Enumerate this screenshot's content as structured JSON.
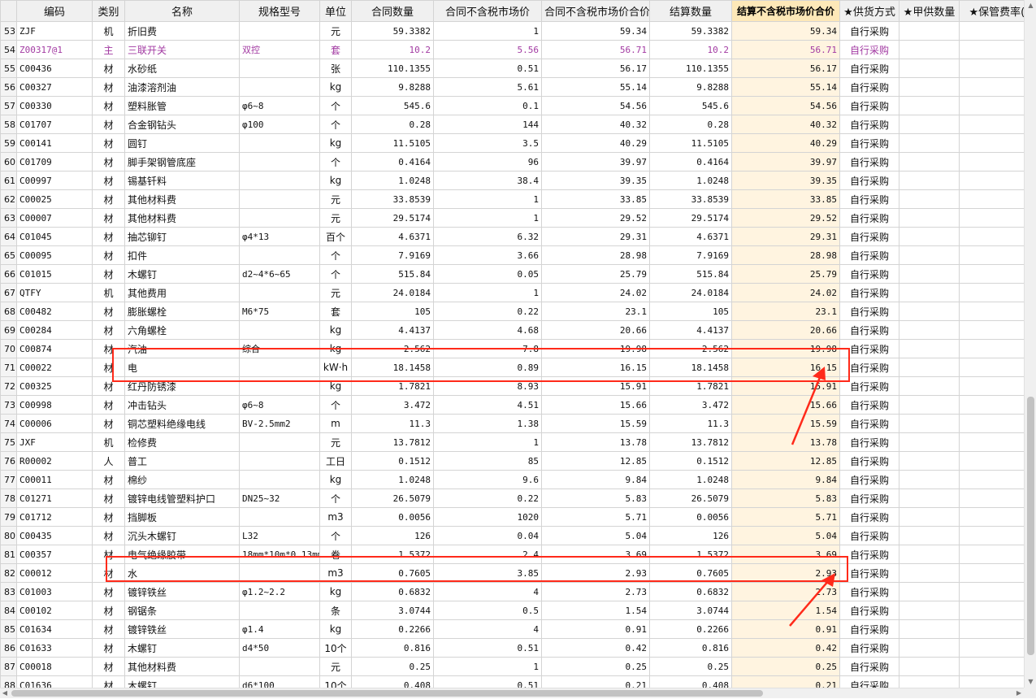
{
  "columns": [
    "编码",
    "类别",
    "名称",
    "规格型号",
    "单位",
    "合同数量",
    "合同不含税市场价",
    "合同不含税市场价合价",
    "结算数量",
    "结算不含税市场价合价",
    "★供货方式",
    "★甲供数量",
    "★保管费率(%"
  ],
  "rows": [
    {
      "n": "53",
      "code": "ZJF",
      "type": "机",
      "name": "折旧费",
      "spec": "",
      "unit": "元",
      "qty": "59.3382",
      "price": "1",
      "total": "59.34",
      "sqty": "59.3382",
      "stotal": "59.34",
      "supply": "自行采购"
    },
    {
      "n": "54",
      "code": "Z00317@1",
      "type": "主",
      "name": "三联开关",
      "spec": "双控",
      "unit": "套",
      "qty": "10.2",
      "price": "5.56",
      "total": "56.71",
      "sqty": "10.2",
      "stotal": "56.71",
      "supply": "自行采购",
      "purple": true
    },
    {
      "n": "55",
      "code": "C00436",
      "type": "材",
      "name": "水砂纸",
      "spec": "",
      "unit": "张",
      "qty": "110.1355",
      "price": "0.51",
      "total": "56.17",
      "sqty": "110.1355",
      "stotal": "56.17",
      "supply": "自行采购"
    },
    {
      "n": "56",
      "code": "C00327",
      "type": "材",
      "name": "油漆溶剂油",
      "spec": "",
      "unit": "kg",
      "qty": "9.8288",
      "price": "5.61",
      "total": "55.14",
      "sqty": "9.8288",
      "stotal": "55.14",
      "supply": "自行采购"
    },
    {
      "n": "57",
      "code": "C00330",
      "type": "材",
      "name": "塑料胀管",
      "spec": "φ6~8",
      "unit": "个",
      "qty": "545.6",
      "price": "0.1",
      "total": "54.56",
      "sqty": "545.6",
      "stotal": "54.56",
      "supply": "自行采购"
    },
    {
      "n": "58",
      "code": "C01707",
      "type": "材",
      "name": "合金钢钻头",
      "spec": "φ100",
      "unit": "个",
      "qty": "0.28",
      "price": "144",
      "total": "40.32",
      "sqty": "0.28",
      "stotal": "40.32",
      "supply": "自行采购"
    },
    {
      "n": "59",
      "code": "C00141",
      "type": "材",
      "name": "圆钉",
      "spec": "",
      "unit": "kg",
      "qty": "11.5105",
      "price": "3.5",
      "total": "40.29",
      "sqty": "11.5105",
      "stotal": "40.29",
      "supply": "自行采购"
    },
    {
      "n": "60",
      "code": "C01709",
      "type": "材",
      "name": "脚手架钢管底座",
      "spec": "",
      "unit": "个",
      "qty": "0.4164",
      "price": "96",
      "total": "39.97",
      "sqty": "0.4164",
      "stotal": "39.97",
      "supply": "自行采购"
    },
    {
      "n": "61",
      "code": "C00997",
      "type": "材",
      "name": "锡基钎料",
      "spec": "",
      "unit": "kg",
      "qty": "1.0248",
      "price": "38.4",
      "total": "39.35",
      "sqty": "1.0248",
      "stotal": "39.35",
      "supply": "自行采购"
    },
    {
      "n": "62",
      "code": "C00025",
      "type": "材",
      "name": "其他材料费",
      "spec": "",
      "unit": "元",
      "qty": "33.8539",
      "price": "1",
      "total": "33.85",
      "sqty": "33.8539",
      "stotal": "33.85",
      "supply": "自行采购"
    },
    {
      "n": "63",
      "code": "C00007",
      "type": "材",
      "name": "其他材料费",
      "spec": "",
      "unit": "元",
      "qty": "29.5174",
      "price": "1",
      "total": "29.52",
      "sqty": "29.5174",
      "stotal": "29.52",
      "supply": "自行采购"
    },
    {
      "n": "64",
      "code": "C01045",
      "type": "材",
      "name": "抽芯铆钉",
      "spec": "φ4*13",
      "unit": "百个",
      "qty": "4.6371",
      "price": "6.32",
      "total": "29.31",
      "sqty": "4.6371",
      "stotal": "29.31",
      "supply": "自行采购"
    },
    {
      "n": "65",
      "code": "C00095",
      "type": "材",
      "name": "扣件",
      "spec": "",
      "unit": "个",
      "qty": "7.9169",
      "price": "3.66",
      "total": "28.98",
      "sqty": "7.9169",
      "stotal": "28.98",
      "supply": "自行采购"
    },
    {
      "n": "66",
      "code": "C01015",
      "type": "材",
      "name": "木螺钉",
      "spec": "d2~4*6~65",
      "unit": "个",
      "qty": "515.84",
      "price": "0.05",
      "total": "25.79",
      "sqty": "515.84",
      "stotal": "25.79",
      "supply": "自行采购"
    },
    {
      "n": "67",
      "code": "QTFY",
      "type": "机",
      "name": "其他费用",
      "spec": "",
      "unit": "元",
      "qty": "24.0184",
      "price": "1",
      "total": "24.02",
      "sqty": "24.0184",
      "stotal": "24.02",
      "supply": "自行采购"
    },
    {
      "n": "68",
      "code": "C00482",
      "type": "材",
      "name": "膨胀螺栓",
      "spec": "M6*75",
      "unit": "套",
      "qty": "105",
      "price": "0.22",
      "total": "23.1",
      "sqty": "105",
      "stotal": "23.1",
      "supply": "自行采购"
    },
    {
      "n": "69",
      "code": "C00284",
      "type": "材",
      "name": "六角螺栓",
      "spec": "",
      "unit": "kg",
      "qty": "4.4137",
      "price": "4.68",
      "total": "20.66",
      "sqty": "4.4137",
      "stotal": "20.66",
      "supply": "自行采购"
    },
    {
      "n": "70",
      "code": "C00874",
      "type": "材",
      "name": "汽油",
      "spec": "综合",
      "unit": "kg",
      "qty": "2.562",
      "price": "7.8",
      "total": "19.98",
      "sqty": "2.562",
      "stotal": "19.98",
      "supply": "自行采购"
    },
    {
      "n": "71",
      "code": "C00022",
      "type": "材",
      "name": "电",
      "spec": "",
      "unit": "kW·h",
      "qty": "18.1458",
      "price": "0.89",
      "total": "16.15",
      "sqty": "18.1458",
      "stotal": "16.15",
      "supply": "自行采购"
    },
    {
      "n": "72",
      "code": "C00325",
      "type": "材",
      "name": "红丹防锈漆",
      "spec": "",
      "unit": "kg",
      "qty": "1.7821",
      "price": "8.93",
      "total": "15.91",
      "sqty": "1.7821",
      "stotal": "15.91",
      "supply": "自行采购"
    },
    {
      "n": "73",
      "code": "C00998",
      "type": "材",
      "name": "冲击钻头",
      "spec": "φ6~8",
      "unit": "个",
      "qty": "3.472",
      "price": "4.51",
      "total": "15.66",
      "sqty": "3.472",
      "stotal": "15.66",
      "supply": "自行采购"
    },
    {
      "n": "74",
      "code": "C00006",
      "type": "材",
      "name": "铜芯塑料绝缘电线",
      "spec": "BV-2.5mm2",
      "unit": "m",
      "qty": "11.3",
      "price": "1.38",
      "total": "15.59",
      "sqty": "11.3",
      "stotal": "15.59",
      "supply": "自行采购"
    },
    {
      "n": "75",
      "code": "JXF",
      "type": "机",
      "name": "检修费",
      "spec": "",
      "unit": "元",
      "qty": "13.7812",
      "price": "1",
      "total": "13.78",
      "sqty": "13.7812",
      "stotal": "13.78",
      "supply": "自行采购"
    },
    {
      "n": "76",
      "code": "R00002",
      "type": "人",
      "name": "普工",
      "spec": "",
      "unit": "工日",
      "qty": "0.1512",
      "price": "85",
      "total": "12.85",
      "sqty": "0.1512",
      "stotal": "12.85",
      "supply": "自行采购"
    },
    {
      "n": "77",
      "code": "C00011",
      "type": "材",
      "name": "棉纱",
      "spec": "",
      "unit": "kg",
      "qty": "1.0248",
      "price": "9.6",
      "total": "9.84",
      "sqty": "1.0248",
      "stotal": "9.84",
      "supply": "自行采购"
    },
    {
      "n": "78",
      "code": "C01271",
      "type": "材",
      "name": "镀锌电线管塑料护口",
      "spec": "DN25~32",
      "unit": "个",
      "qty": "26.5079",
      "price": "0.22",
      "total": "5.83",
      "sqty": "26.5079",
      "stotal": "5.83",
      "supply": "自行采购"
    },
    {
      "n": "79",
      "code": "C01712",
      "type": "材",
      "name": "挡脚板",
      "spec": "",
      "unit": "m3",
      "qty": "0.0056",
      "price": "1020",
      "total": "5.71",
      "sqty": "0.0056",
      "stotal": "5.71",
      "supply": "自行采购"
    },
    {
      "n": "80",
      "code": "C00435",
      "type": "材",
      "name": "沉头木螺钉",
      "spec": "L32",
      "unit": "个",
      "qty": "126",
      "price": "0.04",
      "total": "5.04",
      "sqty": "126",
      "stotal": "5.04",
      "supply": "自行采购"
    },
    {
      "n": "81",
      "code": "C00357",
      "type": "材",
      "name": "电气绝缘胶带",
      "spec": "18mm*10m*0.13mm",
      "unit": "卷",
      "qty": "1.5372",
      "price": "2.4",
      "total": "3.69",
      "sqty": "1.5372",
      "stotal": "3.69",
      "supply": "自行采购"
    },
    {
      "n": "82",
      "code": "C00012",
      "type": "材",
      "name": "水",
      "spec": "",
      "unit": "m3",
      "qty": "0.7605",
      "price": "3.85",
      "total": "2.93",
      "sqty": "0.7605",
      "stotal": "2.93",
      "supply": "自行采购"
    },
    {
      "n": "83",
      "code": "C01003",
      "type": "材",
      "name": "镀锌铁丝",
      "spec": "φ1.2~2.2",
      "unit": "kg",
      "qty": "0.6832",
      "price": "4",
      "total": "2.73",
      "sqty": "0.6832",
      "stotal": "2.73",
      "supply": "自行采购"
    },
    {
      "n": "84",
      "code": "C00102",
      "type": "材",
      "name": "钢锯条",
      "spec": "",
      "unit": "条",
      "qty": "3.0744",
      "price": "0.5",
      "total": "1.54",
      "sqty": "3.0744",
      "stotal": "1.54",
      "supply": "自行采购"
    },
    {
      "n": "85",
      "code": "C01634",
      "type": "材",
      "name": "镀锌铁丝",
      "spec": "φ1.4",
      "unit": "kg",
      "qty": "0.2266",
      "price": "4",
      "total": "0.91",
      "sqty": "0.2266",
      "stotal": "0.91",
      "supply": "自行采购"
    },
    {
      "n": "86",
      "code": "C01633",
      "type": "材",
      "name": "木螺钉",
      "spec": "d4*50",
      "unit": "10个",
      "qty": "0.816",
      "price": "0.51",
      "total": "0.42",
      "sqty": "0.816",
      "stotal": "0.42",
      "supply": "自行采购"
    },
    {
      "n": "87",
      "code": "C00018",
      "type": "材",
      "name": "其他材料费",
      "spec": "",
      "unit": "元",
      "qty": "0.25",
      "price": "1",
      "total": "0.25",
      "sqty": "0.25",
      "stotal": "0.25",
      "supply": "自行采购"
    },
    {
      "n": "88",
      "code": "C01636",
      "type": "材",
      "name": "木螺钉",
      "spec": "d6*100",
      "unit": "10个",
      "qty": "0.408",
      "price": "0.51",
      "total": "0.21",
      "sqty": "0.408",
      "stotal": "0.21",
      "supply": "自行采购"
    }
  ],
  "colors": {
    "highlight_header": "#fde8b8",
    "annotation": "#ff2a1a",
    "purple_row": "#a23aa2"
  },
  "icons": {
    "scroll_up": "triangle-up-icon",
    "scroll_down": "triangle-down-icon",
    "scroll_left": "triangle-left-icon",
    "scroll_right": "triangle-right-icon"
  }
}
